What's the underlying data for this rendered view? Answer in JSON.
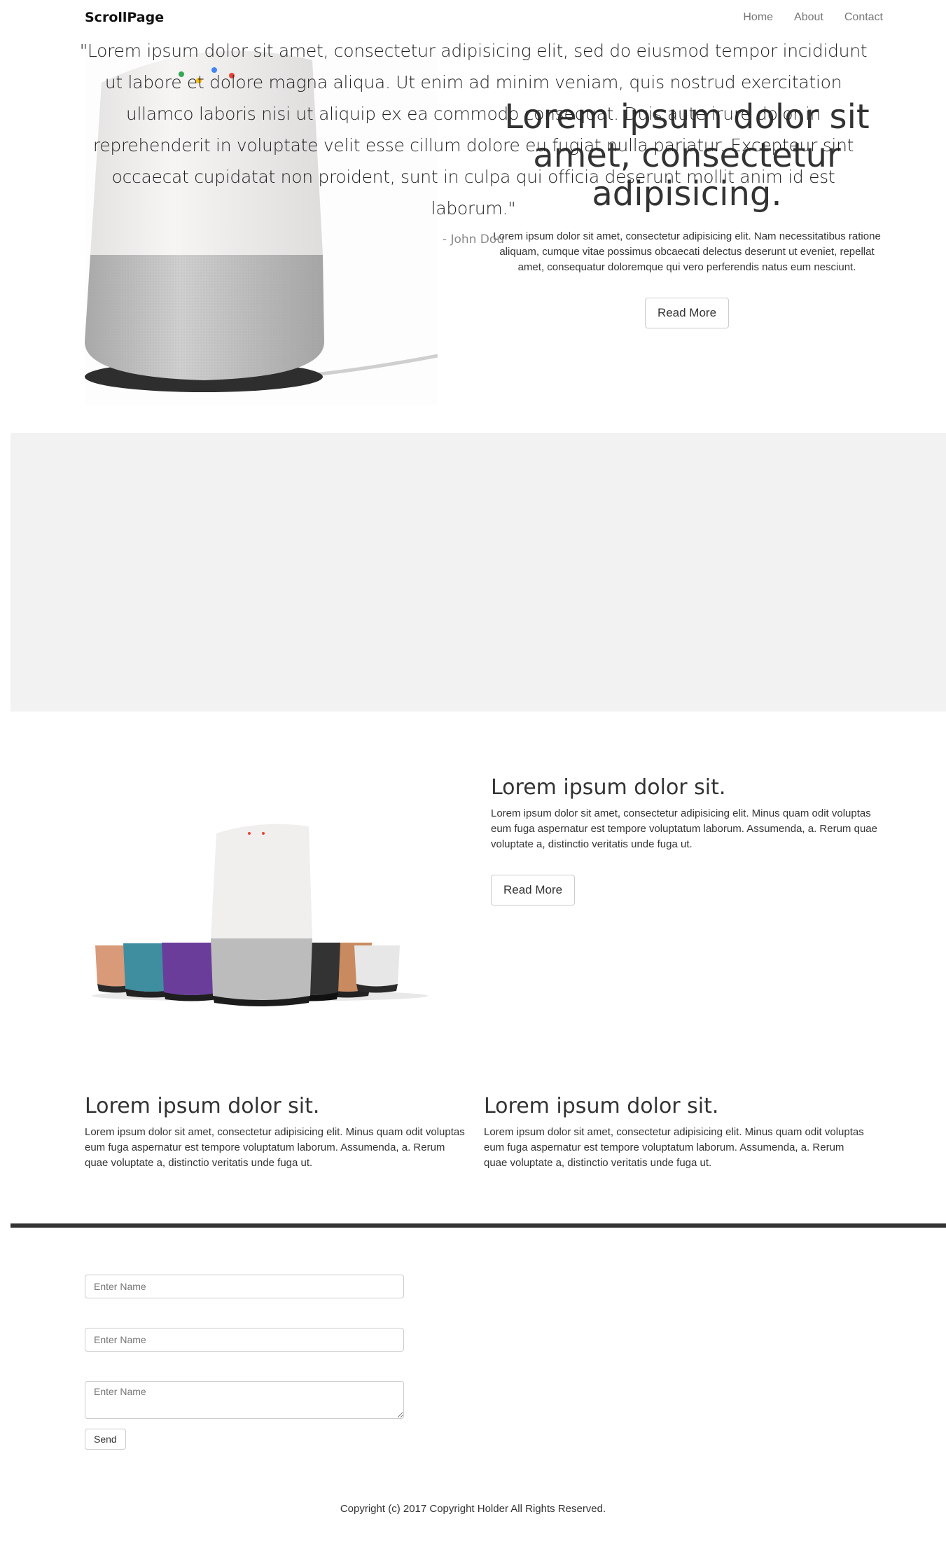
{
  "navbar": {
    "brand": "ScrollPage",
    "links": [
      "Home",
      "About",
      "Contact"
    ]
  },
  "hero": {
    "title": "Lorem ipsum dolor sit amet, consectetur adipisicing.",
    "description": "Lorem ipsum dolor sit amet, consectetur adipisicing elit. Nam necessitatibus ratione aliquam, cumque vitae possimus obcaecati delectus deserunt ut eveniet, repellat amet, consequatur doloremque qui vero perferendis natus eum nesciunt.",
    "button": "Read More"
  },
  "quote": {
    "text": "\"Lorem ipsum dolor sit amet, consectetur adipisicing elit, sed do eiusmod tempor incididunt ut labore et dolore magna aliqua. Ut enim ad minim veniam, quis nostrud exercitation ullamco laboris nisi ut aliquip ex ea commodo consequat. Duis aute irure dolor in reprehenderit in voluptate velit esse cillum dolore eu fugiat nulla pariatur. Excepteur sint occaecat cupidatat non proident, sunt in culpa qui officia deserunt mollit anim id est laborum.\"",
    "author": "- John Dou"
  },
  "feature": {
    "title": "Lorem ipsum dolor sit.",
    "text": "Lorem ipsum dolor sit amet, consectetur adipisicing elit. Minus quam odit voluptas eum fuga aspernatur est tempore voluptatum laborum. Assumenda, a. Rerum quae voluptate a, distinctio veritatis unde fuga ut.",
    "button": "Read More"
  },
  "columns": [
    {
      "title": "Lorem ipsum dolor sit.",
      "text": "Lorem ipsum dolor sit amet, consectetur adipisicing elit. Minus quam odit voluptas eum fuga aspernatur est tempore voluptatum laborum. Assumenda, a. Rerum quae voluptate a, distinctio veritatis unde fuga ut."
    },
    {
      "title": "Lorem ipsum dolor sit.",
      "text": "Lorem ipsum dolor sit amet, consectetur adipisicing elit. Minus quam odit voluptas eum fuga aspernatur est tempore voluptatum laborum. Assumenda, a. Rerum quae voluptate a, distinctio veritatis unde fuga ut."
    }
  ],
  "form": {
    "name_placeholder": "Enter Name",
    "second_placeholder": "Enter Name",
    "message_placeholder": "Enter Name",
    "send_label": "Send"
  },
  "footer": {
    "copyright": "Copyright (c) 2017 Copyright Holder All Rights Reserved."
  },
  "colors": {
    "quote_band": "#f2f2f2",
    "divider": "#333333",
    "speaker_top": "#f0efee",
    "speaker_base": "#b9b9b9"
  }
}
